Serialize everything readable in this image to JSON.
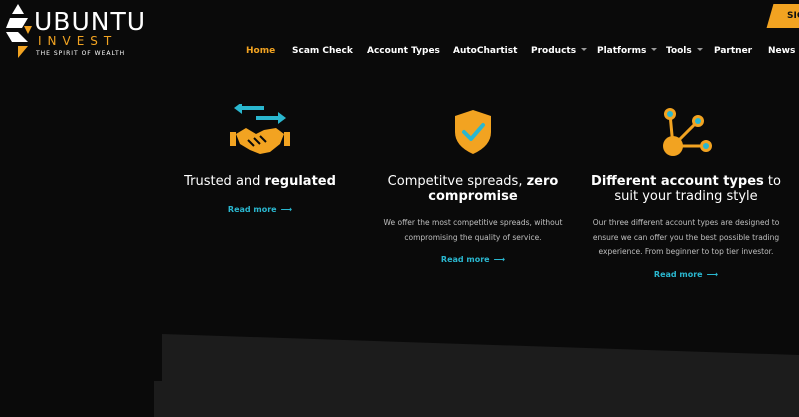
{
  "brand": {
    "name_line1": "UBUNTU",
    "name_line2": "INVEST",
    "tagline": "THE SPIRIT OF WEALTH",
    "accent": "#f2a321"
  },
  "header": {
    "signup_label": "SIG"
  },
  "nav": [
    {
      "label": "Home",
      "active": true,
      "has_caret": false
    },
    {
      "label": "Scam Check",
      "active": false,
      "has_caret": false
    },
    {
      "label": "Account Types",
      "active": false,
      "has_caret": false
    },
    {
      "label": "AutoChartist",
      "active": false,
      "has_caret": false
    },
    {
      "label": "Products",
      "active": false,
      "has_caret": true
    },
    {
      "label": "Platforms",
      "active": false,
      "has_caret": true
    },
    {
      "label": "Tools",
      "active": false,
      "has_caret": true
    },
    {
      "label": "Partner",
      "active": false,
      "has_caret": false
    },
    {
      "label": "News &",
      "active": false,
      "has_caret": false
    }
  ],
  "features": [
    {
      "icon": "handshake-icon",
      "title_plain": "Trusted and ",
      "title_bold": "regulated",
      "description": "",
      "read_more": "Read more"
    },
    {
      "icon": "shield-check-icon",
      "title_plain": "Competitve spreads, ",
      "title_bold": "zero compromise",
      "description": "We offer the most competitive spreads, without compromising the quality of service.",
      "read_more": "Read more"
    },
    {
      "icon": "network-nodes-icon",
      "title_bold": "Different account types",
      "title_plain": " to suit your trading style",
      "description": "Our three different account types are designed to ensure we can offer you the best possible trading experience. From beginner to top tier investor.",
      "read_more": "Read more"
    }
  ],
  "colors": {
    "background": "#0a0a0a",
    "accent": "#f2a321",
    "link": "#2ab7cf",
    "teal": "#2ab7cf"
  }
}
